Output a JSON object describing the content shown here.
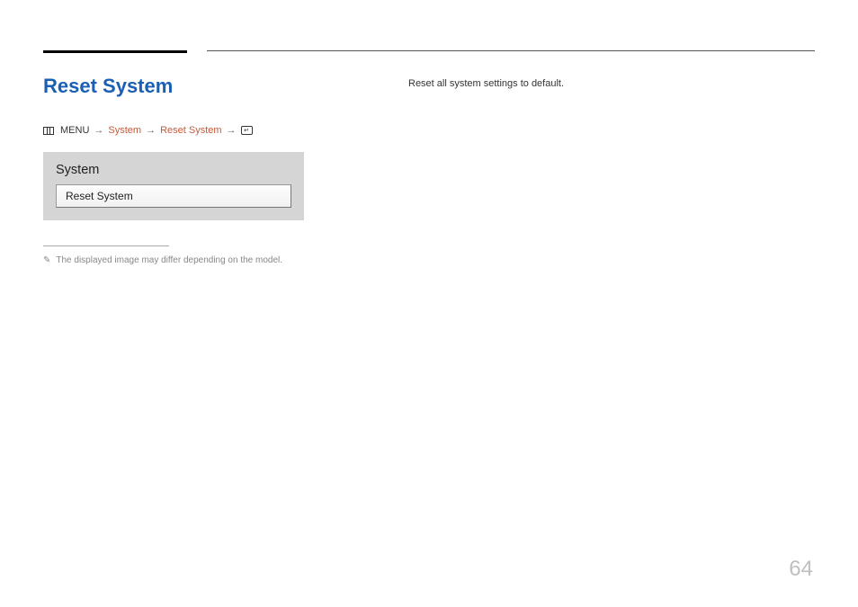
{
  "title": "Reset System",
  "breadcrumb": {
    "menu": "MENU",
    "system": "System",
    "reset": "Reset System"
  },
  "panel": {
    "header": "System",
    "item": "Reset System"
  },
  "footnote": "The displayed image may differ depending on the model.",
  "description": "Reset all system settings to default.",
  "pageNumber": "64"
}
